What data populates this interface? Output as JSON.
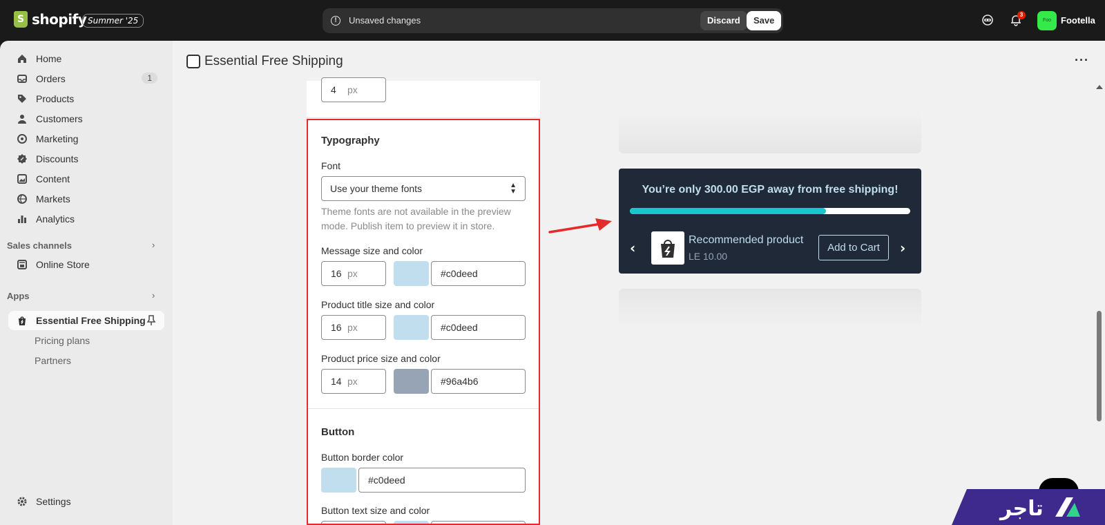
{
  "topbar": {
    "brand": "shopify",
    "edition": "Summer '25",
    "unsaved_text": "Unsaved changes",
    "discard_label": "Discard",
    "save_label": "Save",
    "notification_count": "3",
    "avatar_text": "Foo",
    "store_name": "Footella"
  },
  "sidebar": {
    "items": [
      {
        "label": "Home",
        "icon": "home-icon"
      },
      {
        "label": "Orders",
        "icon": "inbox-icon",
        "badge": "1"
      },
      {
        "label": "Products",
        "icon": "tag-icon"
      },
      {
        "label": "Customers",
        "icon": "person-icon"
      },
      {
        "label": "Marketing",
        "icon": "target-icon"
      },
      {
        "label": "Discounts",
        "icon": "discount-icon"
      },
      {
        "label": "Content",
        "icon": "image-icon"
      },
      {
        "label": "Markets",
        "icon": "globe-icon"
      },
      {
        "label": "Analytics",
        "icon": "bar-chart-icon"
      }
    ],
    "sales_channels_label": "Sales channels",
    "online_store_label": "Online Store",
    "apps_label": "Apps",
    "app_name": "Essential Free Shipping",
    "app_sub": [
      "Pricing plans",
      "Partners"
    ],
    "settings_label": "Settings"
  },
  "page": {
    "title": "Essential Free Shipping"
  },
  "panel": {
    "top_size": "4",
    "unit": "px",
    "typography_heading": "Typography",
    "font_label": "Font",
    "font_value": "Use your theme fonts",
    "font_help": "Theme fonts are not available in the preview mode. Publish item to preview it in store.",
    "message_label": "Message size and color",
    "message_size": "16",
    "message_color": "#c0deed",
    "title_label": "Product title size and color",
    "title_size": "16",
    "title_color": "#c0deed",
    "price_label": "Product price size and color",
    "price_size": "14",
    "price_color": "#96a4b6",
    "button_heading": "Button",
    "button_border_label": "Button border color",
    "button_border_color": "#c0deed",
    "button_text_label": "Button text size and color",
    "swatch_colors": {
      "light": "#c0deed",
      "grey": "#96a4b6"
    }
  },
  "preview": {
    "message": "You’re only 300.00 EGP away from free shipping!",
    "progress": 0.7,
    "product_title": "Recommended product",
    "product_price": "LE 10.00",
    "add_to_cart": "Add to Cart",
    "bar_bg": "#1f2937",
    "progress_color": "#1cc4cc"
  },
  "watermark": {
    "text": "تاجر"
  }
}
